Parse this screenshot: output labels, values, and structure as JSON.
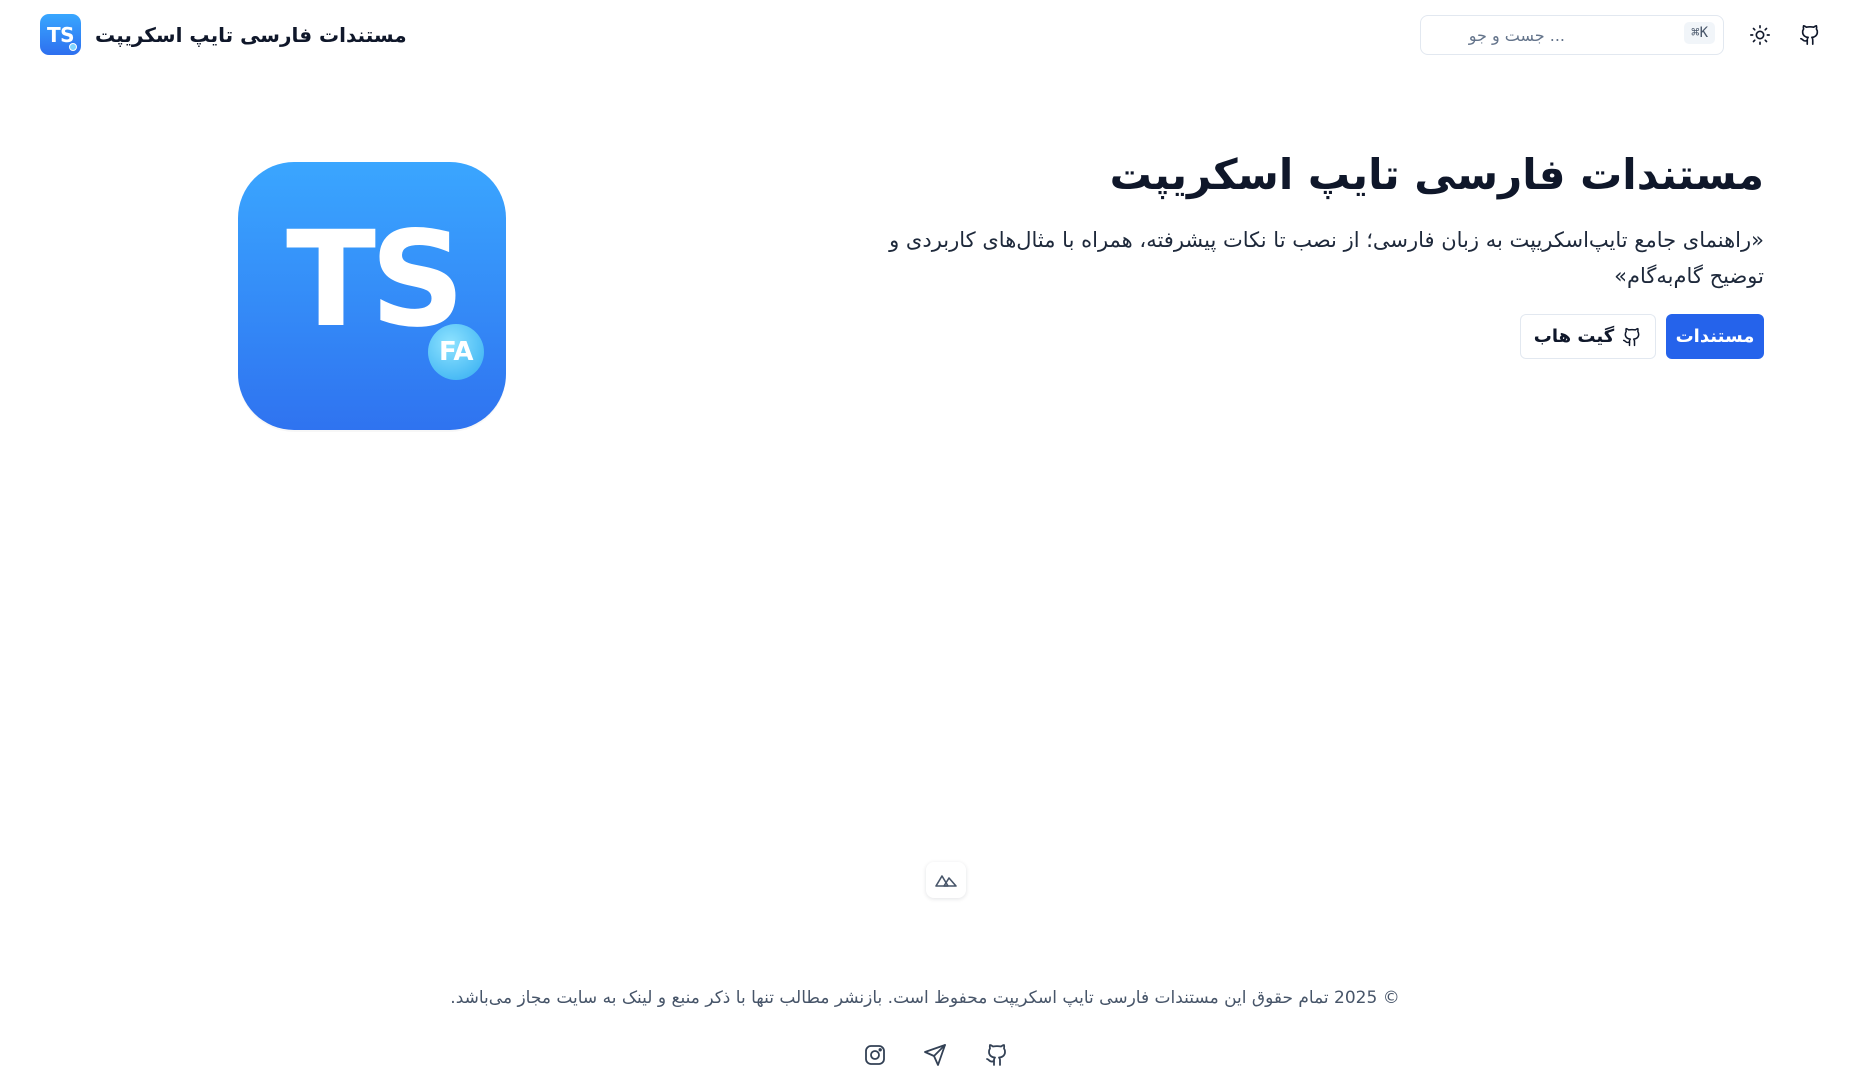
{
  "header": {
    "brand_logo_text": "TS",
    "brand_title": "مستندات فارسی تایپ اسکریپت",
    "search_placeholder": "... جست و جو",
    "search_shortcut": "⌘K",
    "theme_icon": "sun-icon",
    "github_icon": "github-icon"
  },
  "hero": {
    "title": "مستندات فارسی تایپ اسکریپت",
    "description": "«راهنمای جامع تایپ‌اسکریپت به زبان فارسی؛ از نصب تا نکات پیشرفته، همراه با مثال‌های کاربردی و توضیح گام‌به‌گام»",
    "primary_button": "مستندات",
    "secondary_button": "گیت هاب",
    "logo_text": "TS",
    "logo_badge": "FA"
  },
  "colors": {
    "accent": "#2563eb",
    "logo_top": "#3aa6ff",
    "logo_bottom": "#2f73f0",
    "badge": "#4cbcf5"
  },
  "footer": {
    "copyright": "© 2025 تمام حقوق این مستندات فارسی تایپ اسکریپت محفوظ است. بازنشر مطالب تنها با ذکر منبع و لینک به سایت مجاز می‌باشد.",
    "social": [
      "instagram-icon",
      "telegram-icon",
      "github-icon"
    ]
  }
}
